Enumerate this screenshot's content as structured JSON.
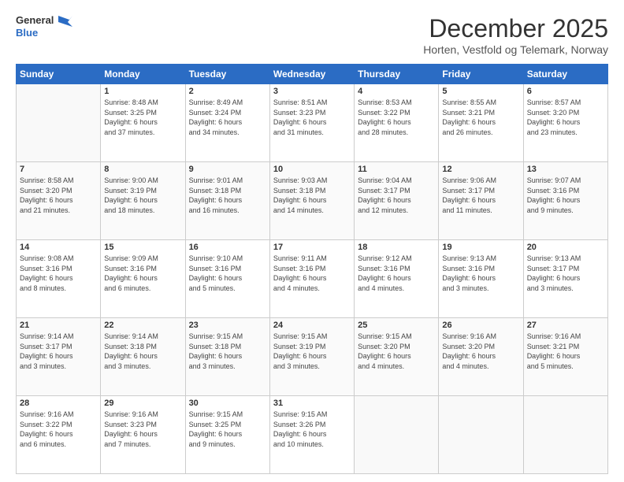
{
  "logo": {
    "line1": "General",
    "line2": "Blue"
  },
  "header": {
    "month": "December 2025",
    "location": "Horten, Vestfold og Telemark, Norway"
  },
  "weekdays": [
    "Sunday",
    "Monday",
    "Tuesday",
    "Wednesday",
    "Thursday",
    "Friday",
    "Saturday"
  ],
  "weeks": [
    [
      {
        "day": "",
        "info": ""
      },
      {
        "day": "1",
        "info": "Sunrise: 8:48 AM\nSunset: 3:25 PM\nDaylight: 6 hours\nand 37 minutes."
      },
      {
        "day": "2",
        "info": "Sunrise: 8:49 AM\nSunset: 3:24 PM\nDaylight: 6 hours\nand 34 minutes."
      },
      {
        "day": "3",
        "info": "Sunrise: 8:51 AM\nSunset: 3:23 PM\nDaylight: 6 hours\nand 31 minutes."
      },
      {
        "day": "4",
        "info": "Sunrise: 8:53 AM\nSunset: 3:22 PM\nDaylight: 6 hours\nand 28 minutes."
      },
      {
        "day": "5",
        "info": "Sunrise: 8:55 AM\nSunset: 3:21 PM\nDaylight: 6 hours\nand 26 minutes."
      },
      {
        "day": "6",
        "info": "Sunrise: 8:57 AM\nSunset: 3:20 PM\nDaylight: 6 hours\nand 23 minutes."
      }
    ],
    [
      {
        "day": "7",
        "info": "Sunrise: 8:58 AM\nSunset: 3:20 PM\nDaylight: 6 hours\nand 21 minutes."
      },
      {
        "day": "8",
        "info": "Sunrise: 9:00 AM\nSunset: 3:19 PM\nDaylight: 6 hours\nand 18 minutes."
      },
      {
        "day": "9",
        "info": "Sunrise: 9:01 AM\nSunset: 3:18 PM\nDaylight: 6 hours\nand 16 minutes."
      },
      {
        "day": "10",
        "info": "Sunrise: 9:03 AM\nSunset: 3:18 PM\nDaylight: 6 hours\nand 14 minutes."
      },
      {
        "day": "11",
        "info": "Sunrise: 9:04 AM\nSunset: 3:17 PM\nDaylight: 6 hours\nand 12 minutes."
      },
      {
        "day": "12",
        "info": "Sunrise: 9:06 AM\nSunset: 3:17 PM\nDaylight: 6 hours\nand 11 minutes."
      },
      {
        "day": "13",
        "info": "Sunrise: 9:07 AM\nSunset: 3:16 PM\nDaylight: 6 hours\nand 9 minutes."
      }
    ],
    [
      {
        "day": "14",
        "info": "Sunrise: 9:08 AM\nSunset: 3:16 PM\nDaylight: 6 hours\nand 8 minutes."
      },
      {
        "day": "15",
        "info": "Sunrise: 9:09 AM\nSunset: 3:16 PM\nDaylight: 6 hours\nand 6 minutes."
      },
      {
        "day": "16",
        "info": "Sunrise: 9:10 AM\nSunset: 3:16 PM\nDaylight: 6 hours\nand 5 minutes."
      },
      {
        "day": "17",
        "info": "Sunrise: 9:11 AM\nSunset: 3:16 PM\nDaylight: 6 hours\nand 4 minutes."
      },
      {
        "day": "18",
        "info": "Sunrise: 9:12 AM\nSunset: 3:16 PM\nDaylight: 6 hours\nand 4 minutes."
      },
      {
        "day": "19",
        "info": "Sunrise: 9:13 AM\nSunset: 3:16 PM\nDaylight: 6 hours\nand 3 minutes."
      },
      {
        "day": "20",
        "info": "Sunrise: 9:13 AM\nSunset: 3:17 PM\nDaylight: 6 hours\nand 3 minutes."
      }
    ],
    [
      {
        "day": "21",
        "info": "Sunrise: 9:14 AM\nSunset: 3:17 PM\nDaylight: 6 hours\nand 3 minutes."
      },
      {
        "day": "22",
        "info": "Sunrise: 9:14 AM\nSunset: 3:18 PM\nDaylight: 6 hours\nand 3 minutes."
      },
      {
        "day": "23",
        "info": "Sunrise: 9:15 AM\nSunset: 3:18 PM\nDaylight: 6 hours\nand 3 minutes."
      },
      {
        "day": "24",
        "info": "Sunrise: 9:15 AM\nSunset: 3:19 PM\nDaylight: 6 hours\nand 3 minutes."
      },
      {
        "day": "25",
        "info": "Sunrise: 9:15 AM\nSunset: 3:20 PM\nDaylight: 6 hours\nand 4 minutes."
      },
      {
        "day": "26",
        "info": "Sunrise: 9:16 AM\nSunset: 3:20 PM\nDaylight: 6 hours\nand 4 minutes."
      },
      {
        "day": "27",
        "info": "Sunrise: 9:16 AM\nSunset: 3:21 PM\nDaylight: 6 hours\nand 5 minutes."
      }
    ],
    [
      {
        "day": "28",
        "info": "Sunrise: 9:16 AM\nSunset: 3:22 PM\nDaylight: 6 hours\nand 6 minutes."
      },
      {
        "day": "29",
        "info": "Sunrise: 9:16 AM\nSunset: 3:23 PM\nDaylight: 6 hours\nand 7 minutes."
      },
      {
        "day": "30",
        "info": "Sunrise: 9:15 AM\nSunset: 3:25 PM\nDaylight: 6 hours\nand 9 minutes."
      },
      {
        "day": "31",
        "info": "Sunrise: 9:15 AM\nSunset: 3:26 PM\nDaylight: 6 hours\nand 10 minutes."
      },
      {
        "day": "",
        "info": ""
      },
      {
        "day": "",
        "info": ""
      },
      {
        "day": "",
        "info": ""
      }
    ]
  ]
}
